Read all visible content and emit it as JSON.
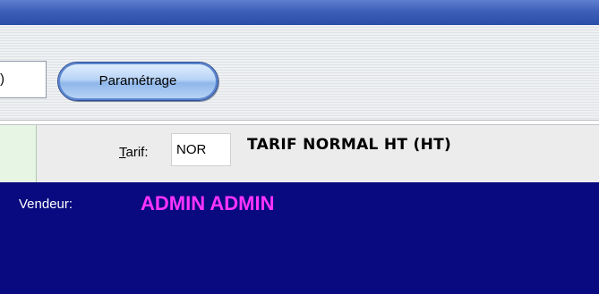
{
  "toolbar": {
    "code_value": ")",
    "param_label": "Paramétrage"
  },
  "tarif": {
    "label_prefix": "T",
    "label_rest": "arif:",
    "code": "NOR",
    "description": "TARIF NORMAL HT (HT)"
  },
  "vendeur": {
    "label": "Vendeur:",
    "value": "ADMIN ADMIN"
  },
  "colors": {
    "panel_bg": "#0a0a80",
    "vendeur_value": "#ff33ff"
  }
}
